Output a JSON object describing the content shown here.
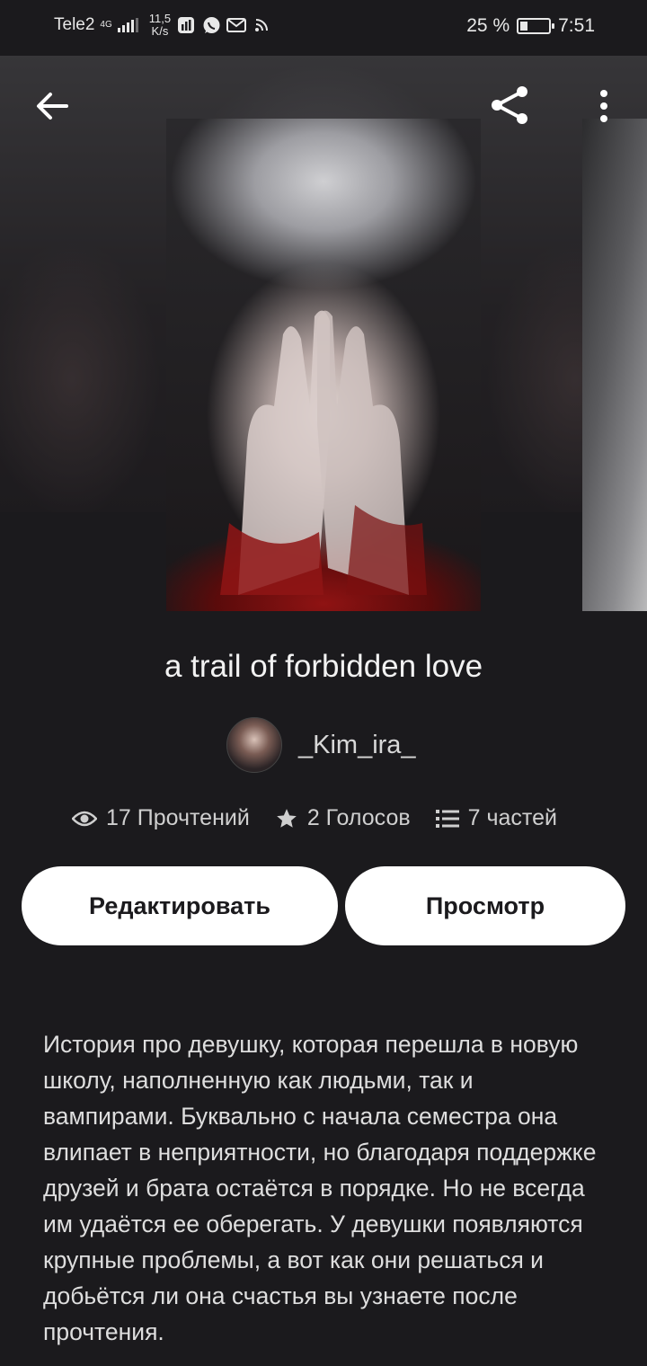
{
  "status_bar": {
    "carrier": "Tele2",
    "network": "4G",
    "speed_value": "11,5",
    "speed_unit": "K/s",
    "battery_text": "25 %",
    "battery_level": 0.25,
    "time": "7:51",
    "app_icons": [
      "stats-icon",
      "whatsapp-icon",
      "mail-icon",
      "wifi-icon"
    ]
  },
  "toolbar": {
    "back_icon": "arrow-left-icon",
    "share_icon": "share-icon",
    "more_icon": "more-vertical-icon"
  },
  "story": {
    "title": "a trail of forbidden love",
    "author": "_Kim_ira_",
    "stats": {
      "reads": "17 Прочтений",
      "votes": "2 Голосов",
      "parts": "7 частей"
    },
    "description": "История про девушку, которая перешла в новую школу, наполненную как людьми, так и вампирами. Буквально с начала семестра она влипает в неприятности, но благодаря поддержке друзей и брата остаётся в порядке. Но не всегда им удаётся ее оберегать. У девушки появляются крупные проблемы, а вот как они решаться и добьётся ли она счастья вы узнаете после прочтения."
  },
  "actions": {
    "edit_label": "Редактировать",
    "preview_label": "Просмотр"
  },
  "colors": {
    "background": "#1b1a1d",
    "button_bg": "#ffffff",
    "button_text": "#1b1a1d"
  }
}
